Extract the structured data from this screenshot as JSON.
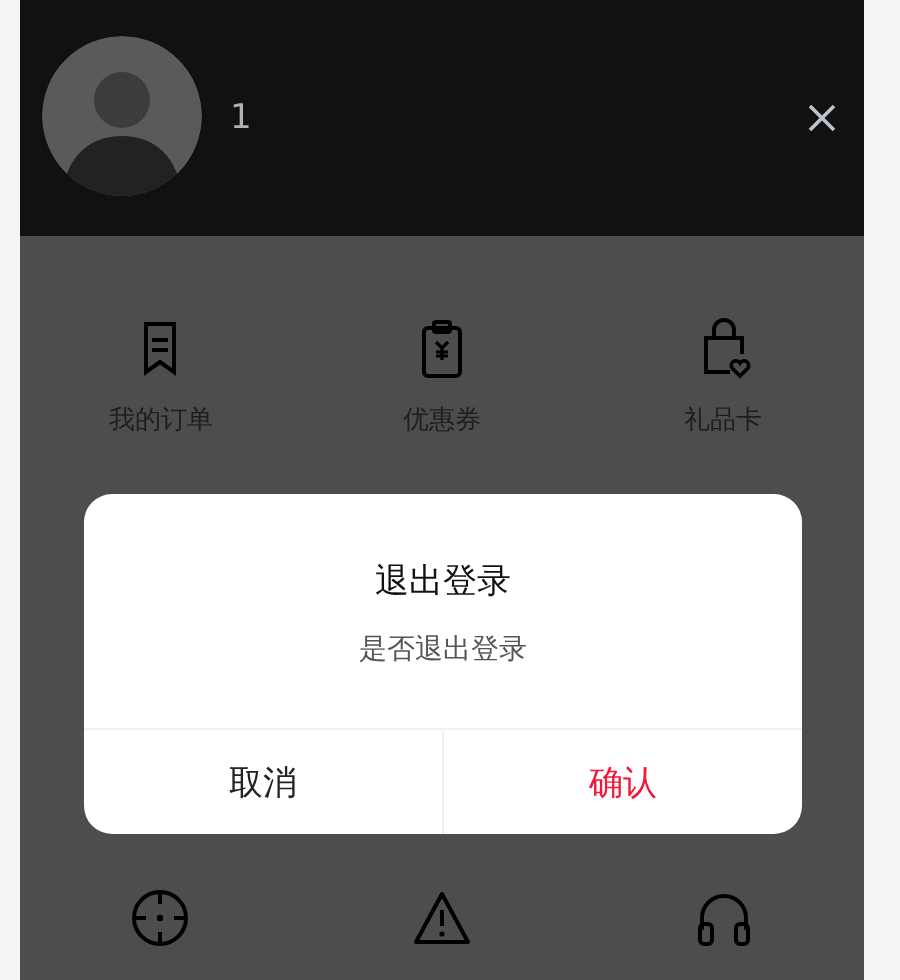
{
  "header": {
    "username": "1"
  },
  "menu": [
    {
      "label": "我的订单",
      "kind": "order"
    },
    {
      "label": "优惠券",
      "kind": "coupon"
    },
    {
      "label": "礼品卡",
      "kind": "gift"
    }
  ],
  "menu_row_2": [
    {
      "kind": "target"
    },
    {
      "kind": "warning"
    },
    {
      "kind": "headset"
    }
  ],
  "dimmed": true,
  "dialog": {
    "title": "退出登录",
    "message": "是否退出登录",
    "buttons": [
      {
        "label": "取消",
        "kind": "cancel"
      },
      {
        "label": "确认",
        "kind": "confirm"
      }
    ]
  }
}
